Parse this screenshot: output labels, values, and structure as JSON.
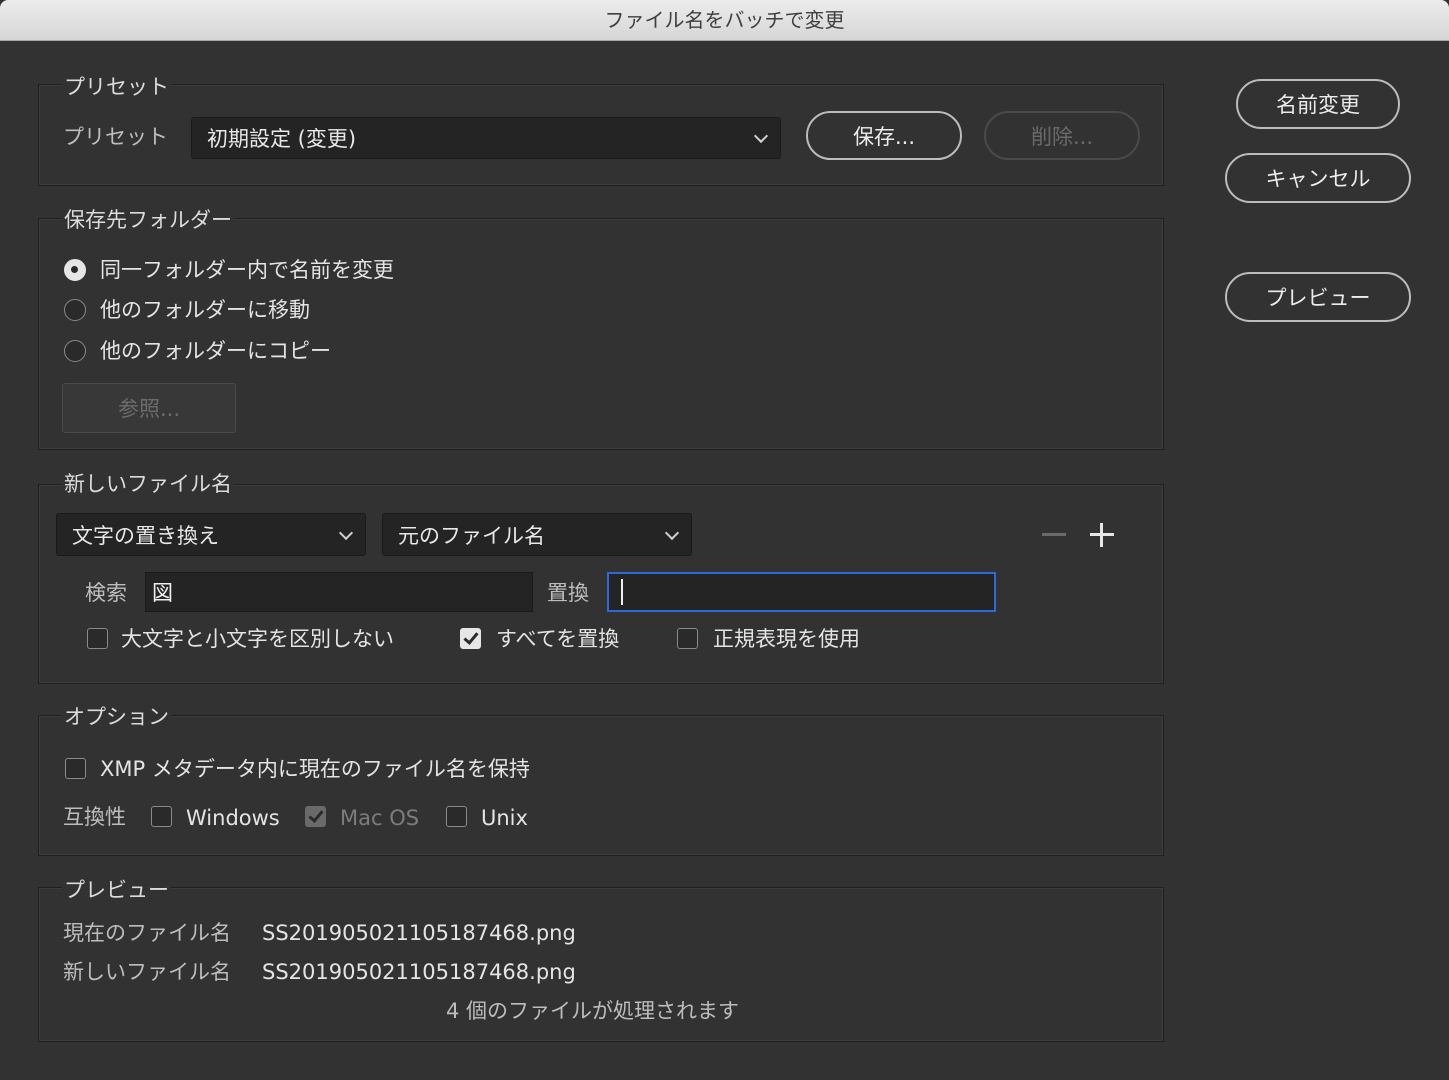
{
  "window": {
    "title": "ファイル名をバッチで変更"
  },
  "preset": {
    "legend": "プリセット",
    "label": "プリセット",
    "selected": "初期設定 (変更)",
    "save_label": "保存...",
    "delete_label": "削除..."
  },
  "destination": {
    "legend": "保存先フォルダー",
    "options": [
      {
        "label": "同一フォルダー内で名前を変更",
        "selected": true
      },
      {
        "label": "他のフォルダーに移動",
        "selected": false
      },
      {
        "label": "他のフォルダーにコピー",
        "selected": false
      }
    ],
    "browse_label": "参照..."
  },
  "new_name": {
    "legend": "新しいファイル名",
    "rule_type": "文字の置き換え",
    "rule_source": "元のファイル名",
    "find_label": "検索",
    "find_value": "図",
    "replace_label": "置換",
    "replace_value": "",
    "checks": [
      {
        "label": "大文字と小文字を区別しない",
        "checked": false
      },
      {
        "label": "すべてを置換",
        "checked": true
      },
      {
        "label": "正規表現を使用",
        "checked": false
      }
    ]
  },
  "options": {
    "legend": "オプション",
    "xmp_label": "XMP メタデータ内に現在のファイル名を保持",
    "xmp_checked": false,
    "compat_label": "互換性",
    "compat": [
      {
        "label": "Windows",
        "checked": false,
        "disabled": false
      },
      {
        "label": "Mac OS",
        "checked": true,
        "disabled": true
      },
      {
        "label": "Unix",
        "checked": false,
        "disabled": false
      }
    ]
  },
  "preview": {
    "legend": "プレビュー",
    "current_label": "現在のファイル名",
    "current_value": "SS20190502110518746​8.png",
    "new_label": "新しいファイル名",
    "new_value": "SS201905021105187468.png",
    "summary": "4 個のファイルが処理されます"
  },
  "side_buttons": {
    "rename": "名前変更",
    "cancel": "キャンセル",
    "preview": "プレビュー"
  }
}
